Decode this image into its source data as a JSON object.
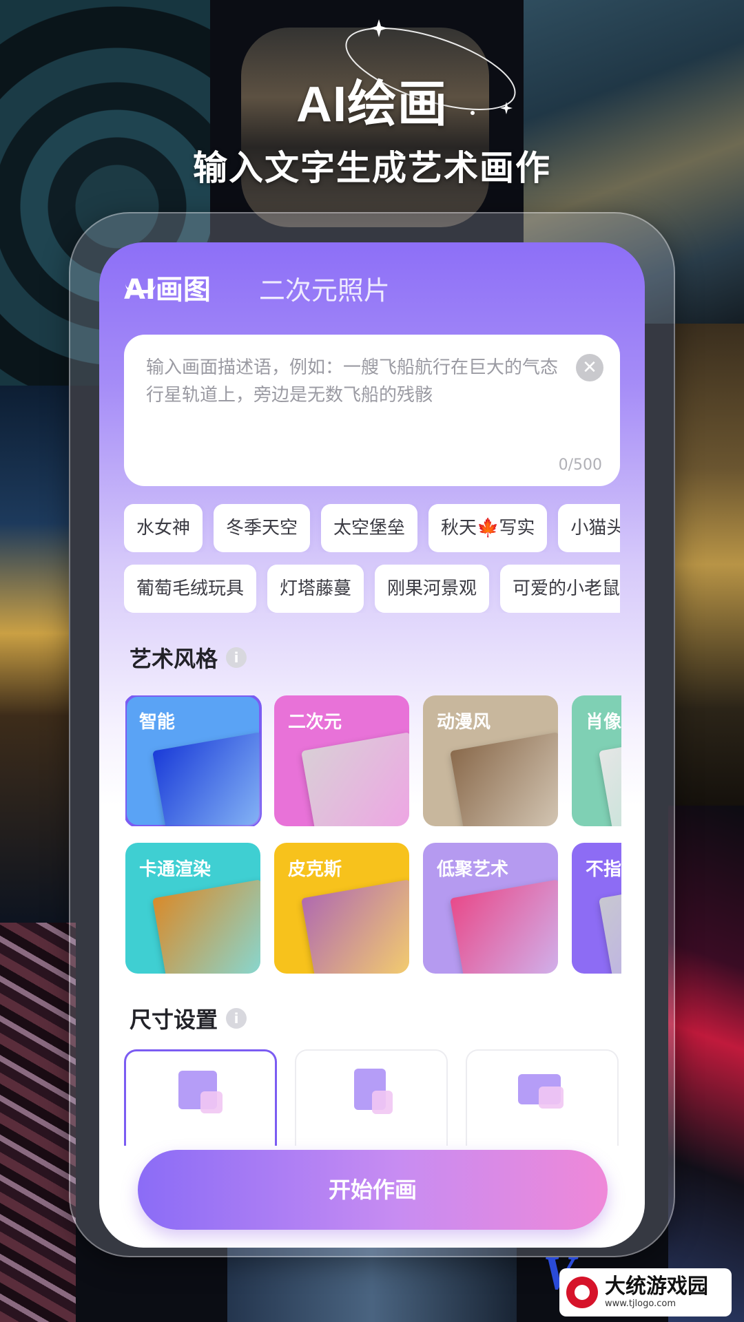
{
  "header": {
    "title": "AI绘画",
    "subtitle": "输入文字生成艺术画作"
  },
  "tabs": [
    {
      "label": "AI画图",
      "active": true
    },
    {
      "label": "二次元照片",
      "active": false
    }
  ],
  "prompt": {
    "placeholder": "输入画面描述语，例如：一艘飞船航行在巨大的气态行星轨道上，旁边是无数飞船的残骸",
    "count": "0/500"
  },
  "chips_row1": [
    "水女神",
    "冬季天空",
    "太空堡垒",
    "秋天🍁写实",
    "小猫头"
  ],
  "chips_row2": [
    "葡萄毛绒玩具",
    "灯塔藤蔓",
    "刚果河景观",
    "可爱的小老鼠"
  ],
  "style_section": {
    "title": "艺术风格"
  },
  "styles_row1": [
    {
      "label": "智能",
      "bg": "#5aa3f5",
      "art": "#1a3bd8",
      "selected": true
    },
    {
      "label": "二次元",
      "bg": "#e872d8",
      "art": "#d9cfd6",
      "selected": false
    },
    {
      "label": "动漫风",
      "bg": "#c8b79d",
      "art": "#8a6a4c",
      "selected": false
    },
    {
      "label": "肖像",
      "bg": "#7fd0b4",
      "art": "#e6e6e6",
      "selected": false
    }
  ],
  "styles_row2": [
    {
      "label": "卡通渲染",
      "bg": "#3fcfd2",
      "art": "#d98a2a",
      "selected": false
    },
    {
      "label": "皮克斯",
      "bg": "#f7c21c",
      "art": "#b06ab0",
      "selected": false
    },
    {
      "label": "低聚艺术",
      "bg": "#b59af0",
      "art": "#e84a8a",
      "selected": false
    },
    {
      "label": "不指",
      "bg": "#8d6cf4",
      "art": "#c8c8d0",
      "selected": false
    }
  ],
  "size_section": {
    "title": "尺寸设置"
  },
  "start_button": "开始作画",
  "watermark": {
    "name": "大统游戏园",
    "url": "www.tjlogo.com"
  },
  "colors": {
    "accent": "#7b5cf2",
    "button_start": "#8b6cf6",
    "button_end": "#ef88d8"
  }
}
